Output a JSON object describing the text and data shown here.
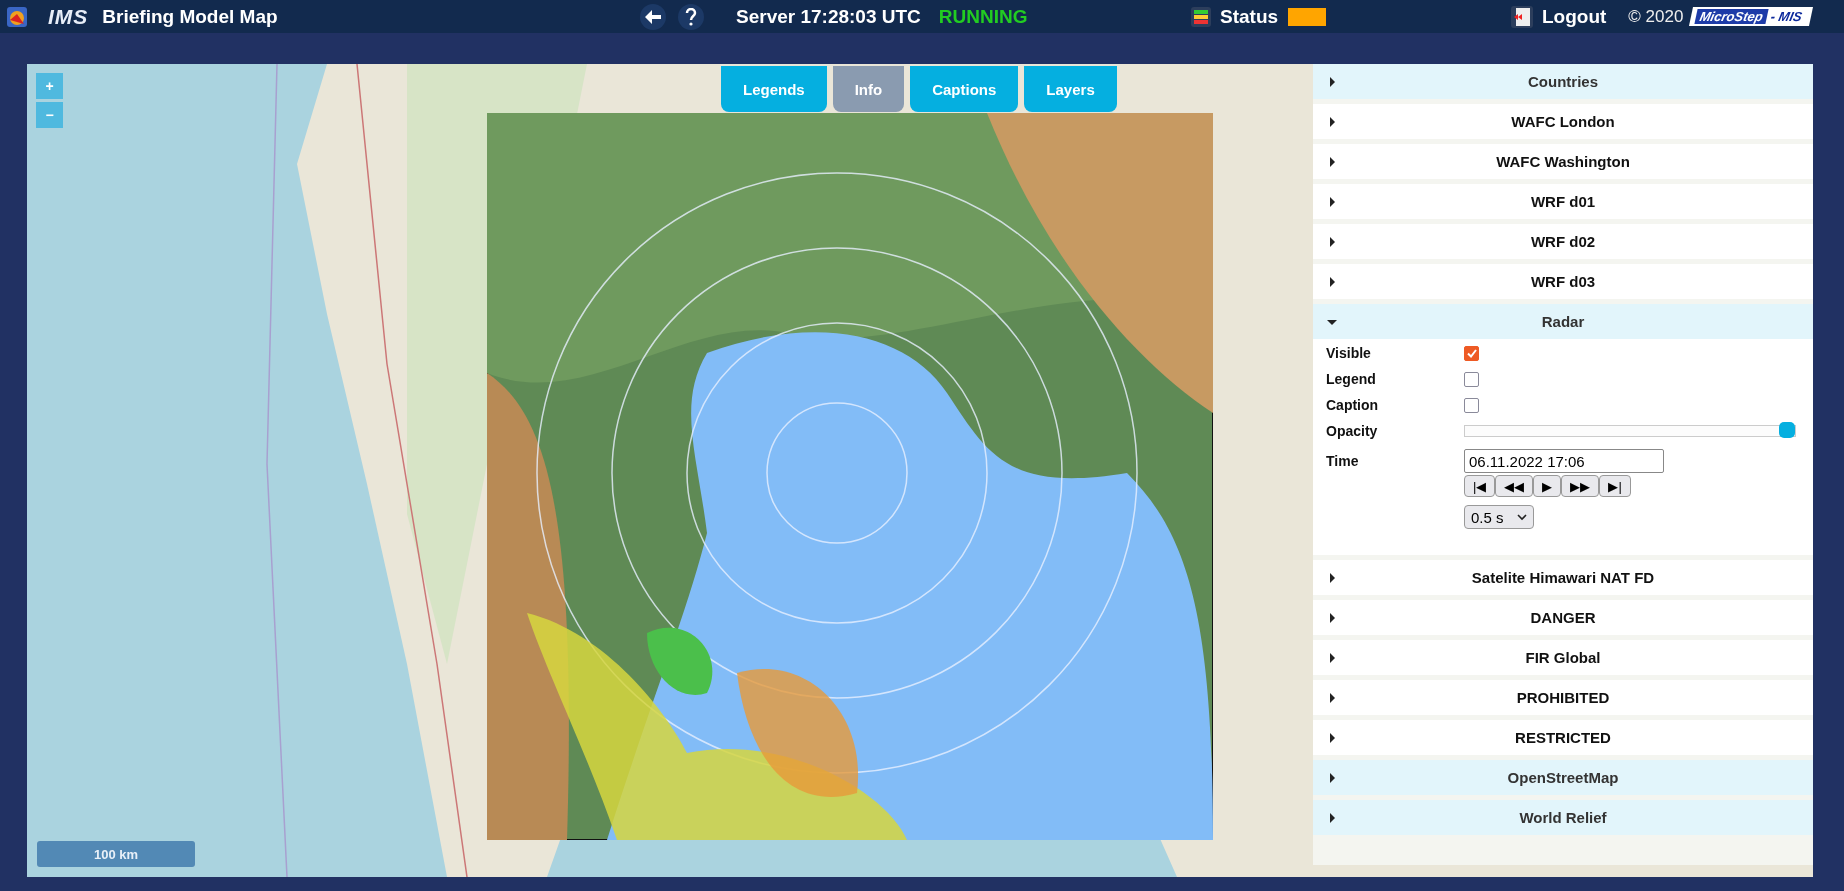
{
  "header": {
    "app_name": "IMS",
    "title": "Briefing Model Map",
    "server_label": "Server 17:28:03 UTC",
    "server_state": "RUNNING",
    "status_label": "Status",
    "logout": "Logout",
    "copyright": "© 2020",
    "logo": [
      "MicroStep",
      "- MIS"
    ]
  },
  "map": {
    "zoom_in": "+",
    "zoom_out": "−",
    "scale": "100 km",
    "tabs": [
      {
        "label": "Legends",
        "selected": false
      },
      {
        "label": "Info",
        "selected": true
      },
      {
        "label": "Captions",
        "selected": false
      },
      {
        "label": "Layers",
        "selected": false
      }
    ]
  },
  "layers": [
    {
      "name": "Countries",
      "active": true,
      "expanded": false
    },
    {
      "name": "WAFC London",
      "active": false,
      "expanded": false
    },
    {
      "name": "WAFC Washington",
      "active": false,
      "expanded": false
    },
    {
      "name": "WRF d01",
      "active": false,
      "expanded": false
    },
    {
      "name": "WRF d02",
      "active": false,
      "expanded": false
    },
    {
      "name": "WRF d03",
      "active": false,
      "expanded": false
    },
    {
      "name": "Radar",
      "active": true,
      "expanded": true,
      "settings": {
        "checks": [
          {
            "label": "Visible",
            "checked": true
          },
          {
            "label": "Legend",
            "checked": false
          },
          {
            "label": "Caption",
            "checked": false
          }
        ],
        "opacity_label": "Opacity",
        "opacity": {
          "level": 1
        },
        "time_label": "Time",
        "time_value": "06.11.2022 17:06",
        "playback": [
          "|◀",
          "◀◀",
          "▶",
          "▶▶",
          "▶|"
        ],
        "speed": "0.5 s"
      }
    },
    {
      "name": "Satelite Himawari NAT FD",
      "active": false,
      "expanded": false
    },
    {
      "name": "DANGER",
      "active": false,
      "expanded": false
    },
    {
      "name": "FIR Global",
      "active": false,
      "expanded": false
    },
    {
      "name": "PROHIBITED",
      "active": false,
      "expanded": false
    },
    {
      "name": "RESTRICTED",
      "active": false,
      "expanded": false
    },
    {
      "name": "OpenStreetMap",
      "active": true,
      "expanded": false
    },
    {
      "name": "World Relief",
      "active": true,
      "expanded": false
    }
  ]
}
